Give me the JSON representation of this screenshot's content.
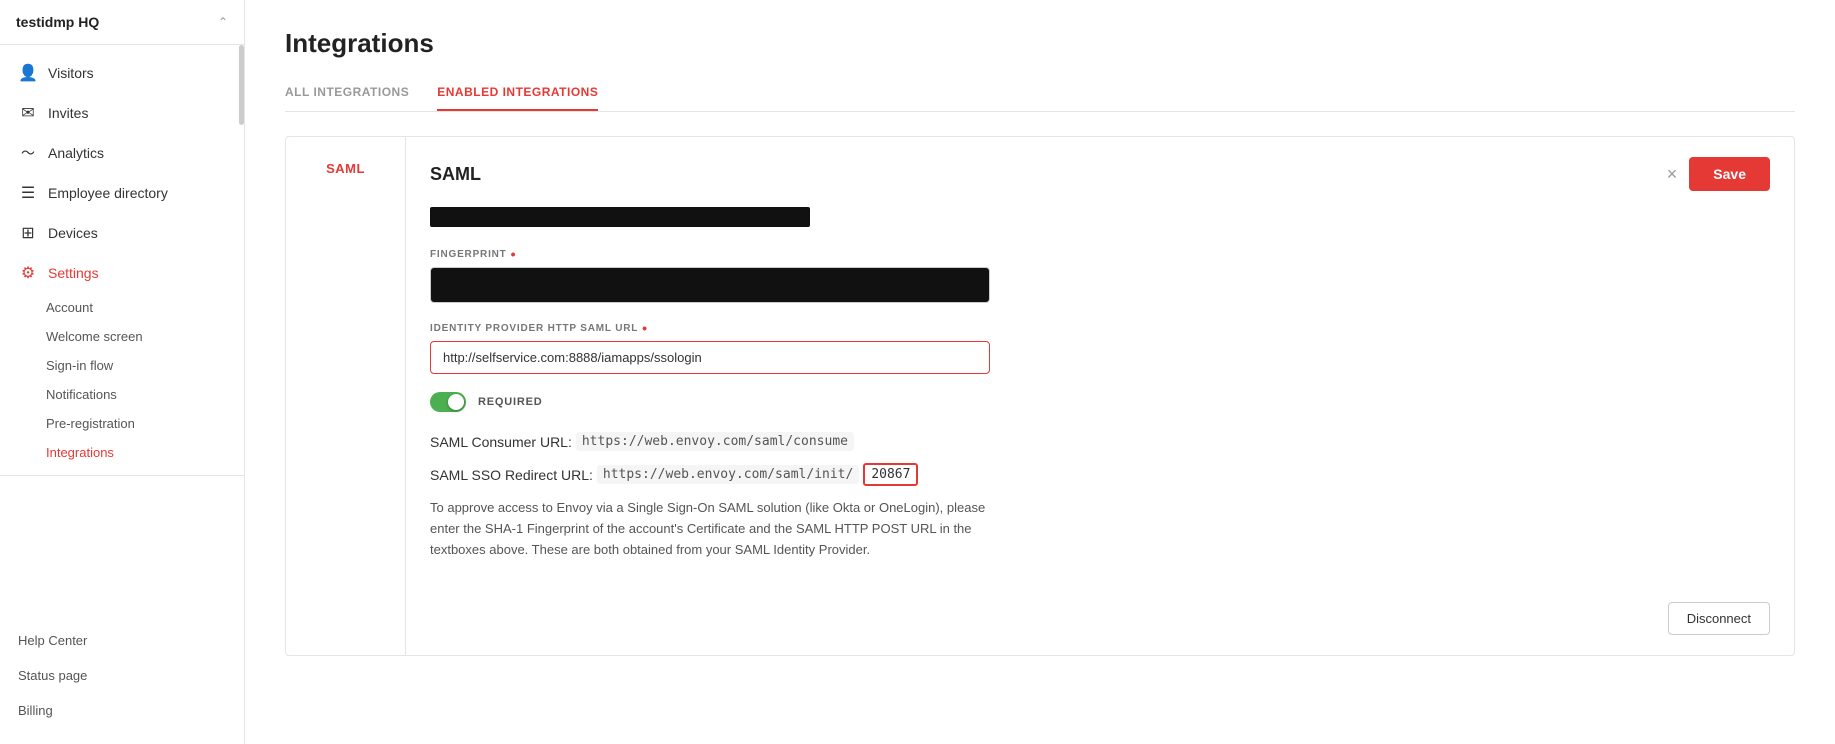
{
  "sidebar": {
    "org_name": "testidmp HQ",
    "nav_items": [
      {
        "id": "visitors",
        "label": "Visitors",
        "icon": "👤"
      },
      {
        "id": "invites",
        "label": "Invites",
        "icon": "✉"
      },
      {
        "id": "analytics",
        "label": "Analytics",
        "icon": "〜"
      },
      {
        "id": "employee-directory",
        "label": "Employee directory",
        "icon": "☰"
      },
      {
        "id": "devices",
        "label": "Devices",
        "icon": "⊞"
      },
      {
        "id": "settings",
        "label": "Settings",
        "icon": "⚙",
        "active": true
      }
    ],
    "sub_nav": [
      {
        "id": "account",
        "label": "Account"
      },
      {
        "id": "welcome-screen",
        "label": "Welcome screen"
      },
      {
        "id": "sign-in-flow",
        "label": "Sign-in flow"
      },
      {
        "id": "notifications",
        "label": "Notifications"
      },
      {
        "id": "pre-registration",
        "label": "Pre-registration"
      },
      {
        "id": "integrations",
        "label": "Integrations",
        "active": true
      }
    ],
    "bottom_items": [
      {
        "id": "help-center",
        "label": "Help Center"
      },
      {
        "id": "status-page",
        "label": "Status page"
      },
      {
        "id": "billing",
        "label": "Billing"
      }
    ]
  },
  "page": {
    "title": "Integrations",
    "tabs": [
      {
        "id": "all",
        "label": "All Integrations"
      },
      {
        "id": "enabled",
        "label": "Enabled Integrations",
        "active": true
      }
    ]
  },
  "saml": {
    "sidebar_label": "SAML",
    "name": "SAML",
    "close_label": "×",
    "save_label": "Save",
    "fingerprint_label": "FINGERPRINT",
    "fingerprint_required": true,
    "idp_url_label": "IDENTITY PROVIDER HTTP SAML URL",
    "idp_url_required": true,
    "idp_url_value": "http://selfservice.com:8888/iamapps/ssologin",
    "required_label": "REQUIRED",
    "consumer_url_key": "SAML Consumer URL:",
    "consumer_url_value": "https://web.envoy.com/saml/consume",
    "sso_redirect_key": "SAML SSO Redirect URL:",
    "sso_redirect_prefix": "https://web.envoy.com/saml/init/",
    "sso_redirect_id": "20867",
    "description": "To approve access to Envoy via a Single Sign-On SAML solution (like Okta or OneLogin), please enter the SHA-1 Fingerprint of the account's Certificate and the SAML HTTP POST URL in the textboxes above. These are both obtained from your SAML Identity Provider.",
    "disconnect_label": "Disconnect"
  }
}
